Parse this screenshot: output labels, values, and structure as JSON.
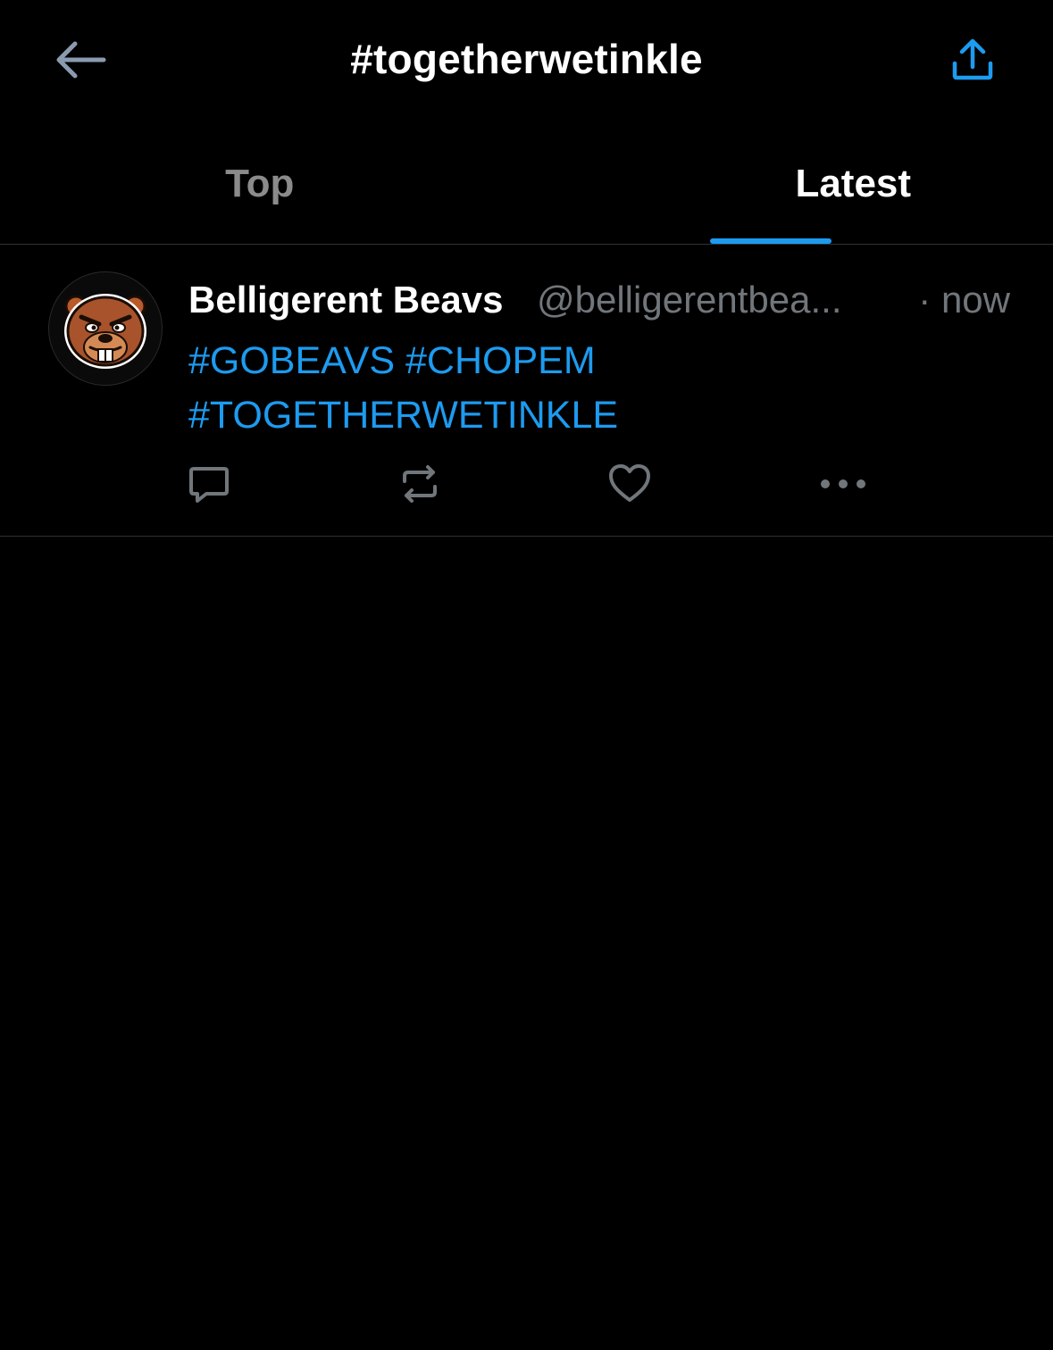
{
  "header": {
    "title": "#togetherwetinkle",
    "back_icon": "arrow-left-icon",
    "share_icon": "share-icon"
  },
  "tabs": [
    {
      "label": "Top",
      "active": false
    },
    {
      "label": "Latest",
      "active": true
    }
  ],
  "tweet": {
    "author_name": "Belligerent Beavs",
    "author_handle": "@belligerentbea...",
    "time": "· now",
    "hashtags_line1": [
      "#GOBEAVS",
      "#CHOPEM"
    ],
    "hashtags_line2": [
      "#TOGETHERWETINKLE"
    ],
    "actions": [
      "reply-icon",
      "retweet-icon",
      "like-icon",
      "more-icon"
    ]
  },
  "colors": {
    "background": "#000000",
    "accent": "#1d9bf0",
    "secondary_text": "#71767b",
    "divider": "#2f3336"
  }
}
